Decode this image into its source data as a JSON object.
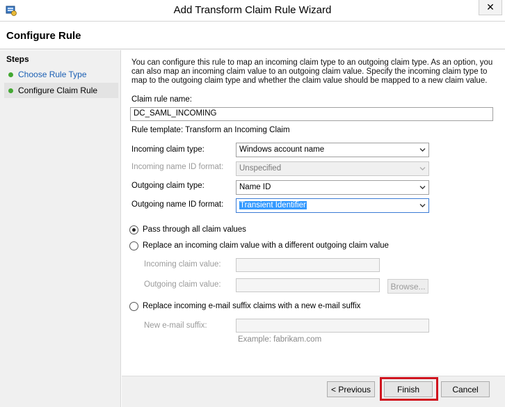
{
  "window": {
    "title": "Add Transform Claim Rule Wizard",
    "close_glyph": "✕"
  },
  "header": {
    "title": "Configure Rule"
  },
  "steps": {
    "title": "Steps",
    "items": [
      {
        "label": "Choose Rule Type"
      },
      {
        "label": "Configure Claim Rule"
      }
    ]
  },
  "main": {
    "description": "You can configure this rule to map an incoming claim type to an outgoing claim type. As an option, you can also map an incoming claim value to an outgoing claim value. Specify the incoming claim type to map to the outgoing claim type and whether the claim value should be mapped to a new claim value.",
    "claim_rule_name_label": "Claim rule name:",
    "claim_rule_name_value": "DC_SAML_INCOMING",
    "rule_template": "Rule template: Transform an Incoming Claim",
    "incoming_claim_type_label": "Incoming claim type:",
    "incoming_claim_type_value": "Windows account name",
    "incoming_name_id_format_label": "Incoming name ID format:",
    "incoming_name_id_format_value": "Unspecified",
    "outgoing_claim_type_label": "Outgoing claim type:",
    "outgoing_claim_type_value": "Name ID",
    "outgoing_name_id_format_label": "Outgoing name ID format:",
    "outgoing_name_id_format_value": "Transient Identifier",
    "radio_pass_through": "Pass through all claim values",
    "radio_replace_value": "Replace an incoming claim value with a different outgoing claim value",
    "incoming_claim_value_label": "Incoming claim value:",
    "outgoing_claim_value_label": "Outgoing claim value:",
    "browse_label": "Browse...",
    "radio_replace_suffix": "Replace incoming e-mail suffix claims with a new e-mail suffix",
    "new_email_suffix_label": "New e-mail suffix:",
    "example_hint": "Example: fabrikam.com"
  },
  "buttons": {
    "previous": "< Previous",
    "finish": "Finish",
    "cancel": "Cancel"
  },
  "colors": {
    "highlight": "#d0141e",
    "link": "#1a5fb4",
    "step_dot": "#44a833",
    "selection": "#3399ff"
  }
}
